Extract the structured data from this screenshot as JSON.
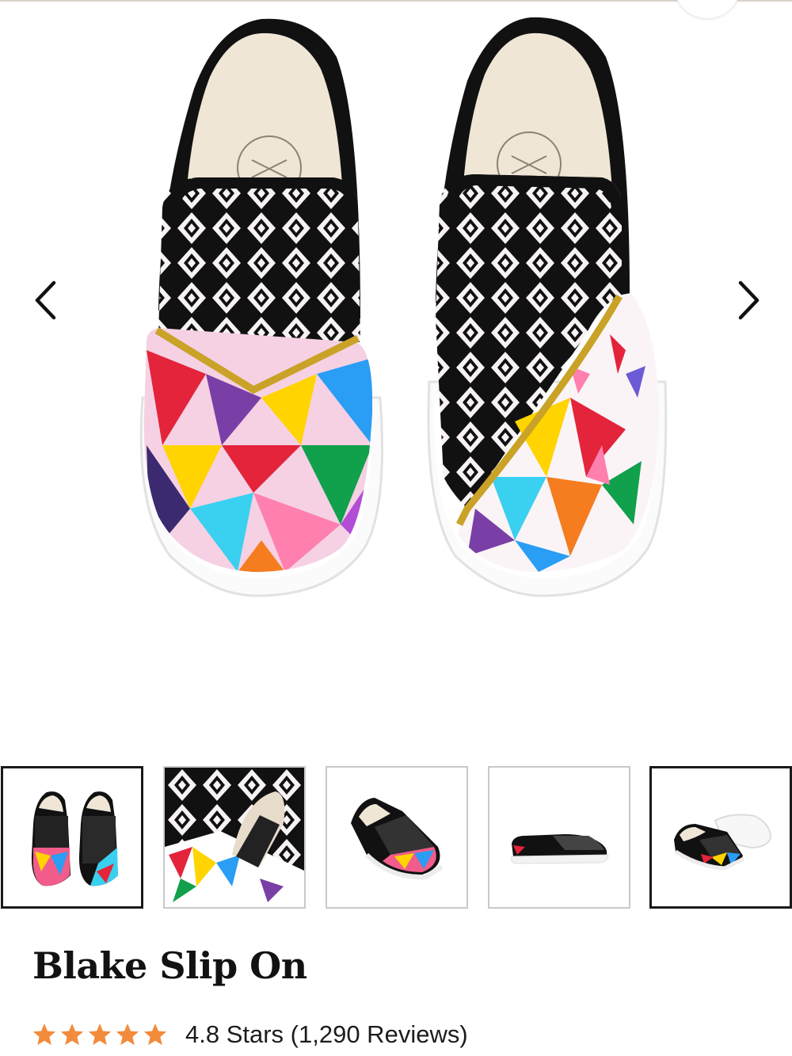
{
  "product": {
    "title": "Blake Slip On",
    "rating_value": 4.8,
    "rating_text": "4.8 Stars (1,290 Reviews)",
    "star_count": 5,
    "star_color": "#f28b3c"
  },
  "gallery": {
    "prev_icon": "chevron-left-icon",
    "next_icon": "chevron-right-icon",
    "thumbnail_count": 5,
    "active_thumbnail": 1
  },
  "colors": {
    "text": "#121212",
    "border_active": "#1a1a1a",
    "border_inactive": "#c9c9c9"
  }
}
